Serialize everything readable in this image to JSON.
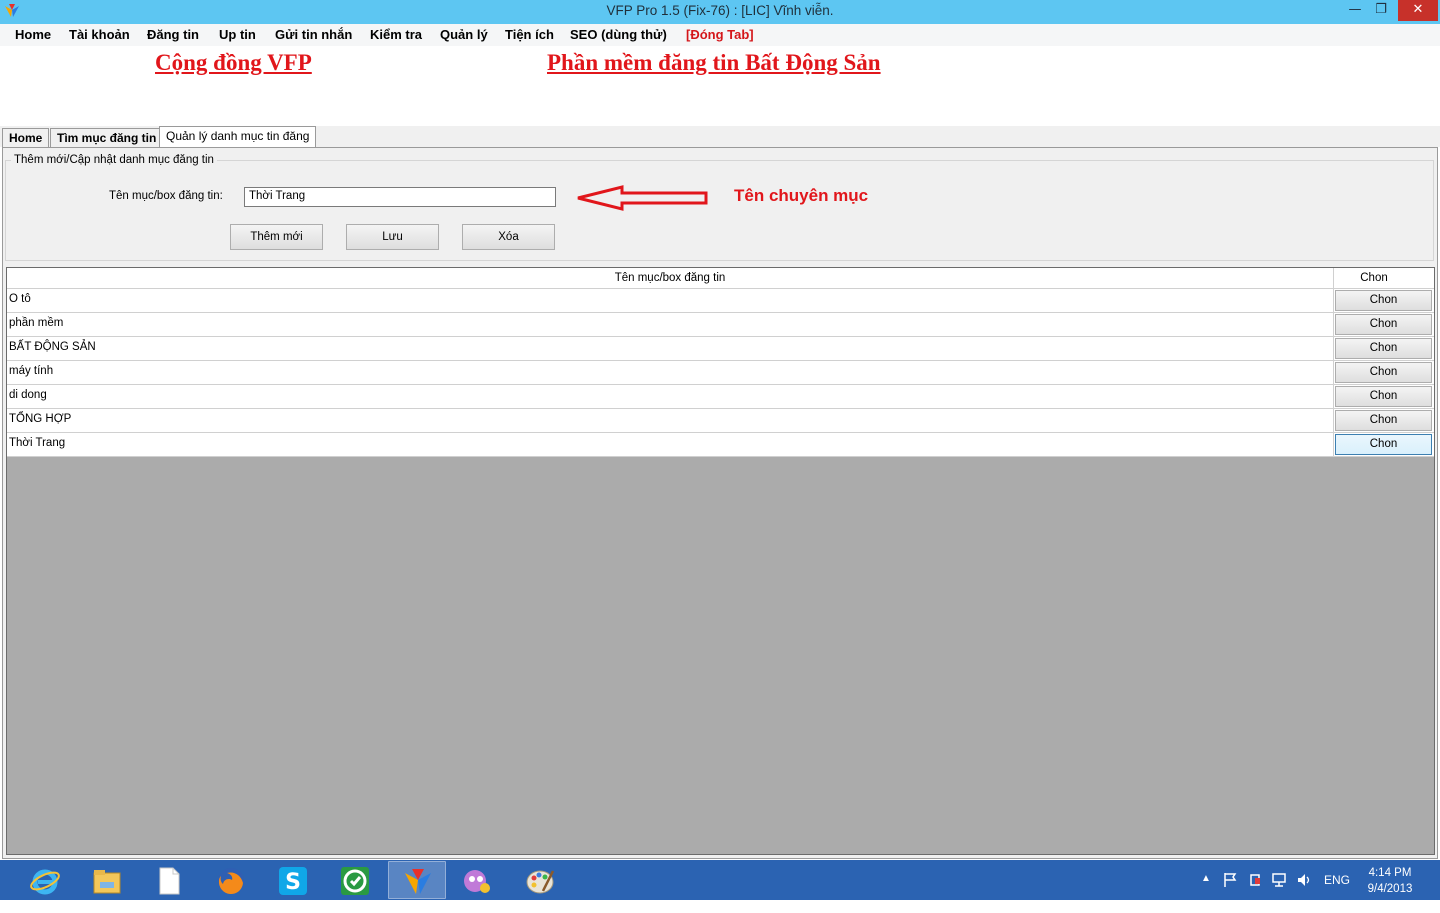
{
  "window": {
    "title": "VFP Pro 1.5 (Fix-76) : [LIC] Vĩnh viễn.",
    "min_glyph": "—",
    "max_glyph": "❐",
    "close_glyph": "✕"
  },
  "menu": [
    {
      "label": "Home"
    },
    {
      "label": "Tài khoản"
    },
    {
      "label": "Đăng tin"
    },
    {
      "label": "Up tin"
    },
    {
      "label": "Gửi tin nhắn"
    },
    {
      "label": "Kiểm tra"
    },
    {
      "label": "Quản lý"
    },
    {
      "label": "Tiện ích"
    },
    {
      "label": "SEO (dùng thử)"
    },
    {
      "label": "[Đóng Tab]"
    }
  ],
  "banner": {
    "left": "Cộng đồng VFP",
    "right": "Phần mềm đăng tin Bất Động Sản"
  },
  "tabs": [
    {
      "label": "Home"
    },
    {
      "label": "Tìm mục đăng tin"
    },
    {
      "label": "Quản lý danh mục tin đăng"
    }
  ],
  "form": {
    "legend": "Thêm mới/Cập nhật danh mục đăng tin",
    "field_label": "Tên mục/box đăng tin:",
    "field_value": "Thời Trang",
    "buttons": {
      "add": "Thêm mới",
      "save": "Lưu",
      "delete": "Xóa"
    },
    "annotation": "Tên chuyên mục"
  },
  "grid": {
    "columns": {
      "name": "Tên mục/box đăng tin",
      "choose": "Chon"
    },
    "rows": [
      {
        "name": "O tô",
        "action": "Chon"
      },
      {
        "name": "phần mềm",
        "action": "Chon"
      },
      {
        "name": "BẤT ĐỘNG SẢN",
        "action": "Chon"
      },
      {
        "name": "máy tính",
        "action": "Chon"
      },
      {
        "name": "di dong",
        "action": "Chon"
      },
      {
        "name": "TỔNG HỢP",
        "action": "Chon"
      },
      {
        "name": "Thời Trang",
        "action": "Chon"
      }
    ]
  },
  "taskbar": {
    "apps": [
      {
        "icon": "internet-explorer-icon"
      },
      {
        "icon": "file-explorer-icon"
      },
      {
        "icon": "blank-document-icon"
      },
      {
        "icon": "firefox-icon"
      },
      {
        "icon": "skype-icon"
      },
      {
        "icon": "coccoc-browser-icon"
      },
      {
        "icon": "vfp-app-icon"
      },
      {
        "icon": "chat-app-icon"
      },
      {
        "icon": "paint-icon"
      }
    ],
    "tray": {
      "chevron": "▲",
      "language": "ENG",
      "time": "4:14 PM",
      "date": "9/4/2013"
    }
  },
  "colors": {
    "titlebar": "#5dc6f2",
    "accent_red": "#e1161b",
    "taskbar": "#2b63b2",
    "grid_background": "#ababab"
  }
}
